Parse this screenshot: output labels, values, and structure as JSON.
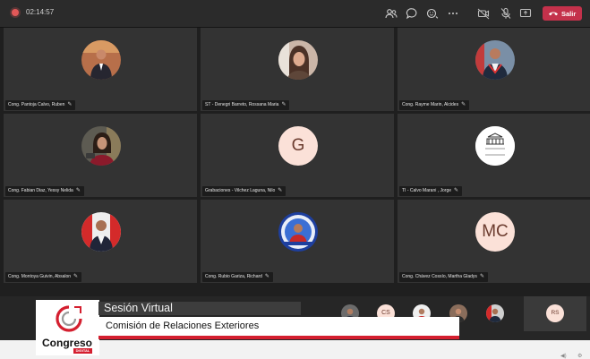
{
  "topbar": {
    "timer": "02:14:57",
    "leave_label": "Salir",
    "icons": [
      "participants-icon",
      "chat-icon",
      "reactions-icon",
      "more-options-icon",
      "camera-icon",
      "mic-icon",
      "share-screen-icon",
      "leave-phone-icon"
    ]
  },
  "participants": [
    {
      "name": "Cong. Pantoja Calvo, Ruben",
      "avatar": "photo"
    },
    {
      "name": "ST - Denegri Barreto, Rossana Maria",
      "avatar": "photo"
    },
    {
      "name": "Cong. Rayme Marin, Alcides",
      "avatar": "photo"
    },
    {
      "name": "Cong. Fabian Diaz, Yessy Nelida",
      "avatar": "photo"
    },
    {
      "name": "Grabaciones - Vilchez Laguna, Nilo",
      "avatar": "initials",
      "initials": "G"
    },
    {
      "name": "TI - Calvo Marani , Jorge",
      "avatar": "logo",
      "logo_text": "CONGRESO REPÚBLICA"
    },
    {
      "name": "Cong. Montoya Guivin, Absalon",
      "avatar": "photo"
    },
    {
      "name": "Cong. Rubio Gariza, Richard",
      "avatar": "photo"
    },
    {
      "name": "Cong. Chávez Cossío, Martha Gladys",
      "avatar": "initials",
      "initials": "MC"
    }
  ],
  "overflow": {
    "thumbnails": [
      "photo",
      "CS",
      "photo",
      "photo",
      "photo"
    ],
    "rs_initials": "RS"
  },
  "banner": {
    "title": "Sesión Virtual",
    "subtitle": "Comisión de Relaciones Exteriores",
    "logo_text": "Congreso",
    "logo_sub": "DIGITAL"
  },
  "colors": {
    "leave": "#c4314b",
    "congreso_red": "#d41f2f",
    "initials_bg": "#fbe1d8"
  }
}
